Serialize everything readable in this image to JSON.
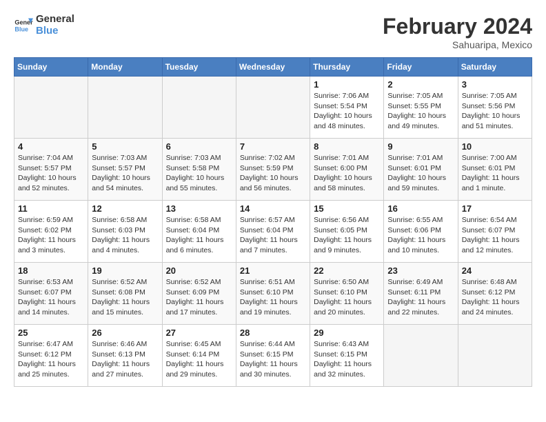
{
  "logo": {
    "line1": "General",
    "line2": "Blue"
  },
  "title": "February 2024",
  "subtitle": "Sahuaripa, Mexico",
  "headers": [
    "Sunday",
    "Monday",
    "Tuesday",
    "Wednesday",
    "Thursday",
    "Friday",
    "Saturday"
  ],
  "weeks": [
    [
      {
        "day": "",
        "info": ""
      },
      {
        "day": "",
        "info": ""
      },
      {
        "day": "",
        "info": ""
      },
      {
        "day": "",
        "info": ""
      },
      {
        "day": "1",
        "info": "Sunrise: 7:06 AM\nSunset: 5:54 PM\nDaylight: 10 hours\nand 48 minutes."
      },
      {
        "day": "2",
        "info": "Sunrise: 7:05 AM\nSunset: 5:55 PM\nDaylight: 10 hours\nand 49 minutes."
      },
      {
        "day": "3",
        "info": "Sunrise: 7:05 AM\nSunset: 5:56 PM\nDaylight: 10 hours\nand 51 minutes."
      }
    ],
    [
      {
        "day": "4",
        "info": "Sunrise: 7:04 AM\nSunset: 5:57 PM\nDaylight: 10 hours\nand 52 minutes."
      },
      {
        "day": "5",
        "info": "Sunrise: 7:03 AM\nSunset: 5:57 PM\nDaylight: 10 hours\nand 54 minutes."
      },
      {
        "day": "6",
        "info": "Sunrise: 7:03 AM\nSunset: 5:58 PM\nDaylight: 10 hours\nand 55 minutes."
      },
      {
        "day": "7",
        "info": "Sunrise: 7:02 AM\nSunset: 5:59 PM\nDaylight: 10 hours\nand 56 minutes."
      },
      {
        "day": "8",
        "info": "Sunrise: 7:01 AM\nSunset: 6:00 PM\nDaylight: 10 hours\nand 58 minutes."
      },
      {
        "day": "9",
        "info": "Sunrise: 7:01 AM\nSunset: 6:01 PM\nDaylight: 10 hours\nand 59 minutes."
      },
      {
        "day": "10",
        "info": "Sunrise: 7:00 AM\nSunset: 6:01 PM\nDaylight: 11 hours\nand 1 minute."
      }
    ],
    [
      {
        "day": "11",
        "info": "Sunrise: 6:59 AM\nSunset: 6:02 PM\nDaylight: 11 hours\nand 3 minutes."
      },
      {
        "day": "12",
        "info": "Sunrise: 6:58 AM\nSunset: 6:03 PM\nDaylight: 11 hours\nand 4 minutes."
      },
      {
        "day": "13",
        "info": "Sunrise: 6:58 AM\nSunset: 6:04 PM\nDaylight: 11 hours\nand 6 minutes."
      },
      {
        "day": "14",
        "info": "Sunrise: 6:57 AM\nSunset: 6:04 PM\nDaylight: 11 hours\nand 7 minutes."
      },
      {
        "day": "15",
        "info": "Sunrise: 6:56 AM\nSunset: 6:05 PM\nDaylight: 11 hours\nand 9 minutes."
      },
      {
        "day": "16",
        "info": "Sunrise: 6:55 AM\nSunset: 6:06 PM\nDaylight: 11 hours\nand 10 minutes."
      },
      {
        "day": "17",
        "info": "Sunrise: 6:54 AM\nSunset: 6:07 PM\nDaylight: 11 hours\nand 12 minutes."
      }
    ],
    [
      {
        "day": "18",
        "info": "Sunrise: 6:53 AM\nSunset: 6:07 PM\nDaylight: 11 hours\nand 14 minutes."
      },
      {
        "day": "19",
        "info": "Sunrise: 6:52 AM\nSunset: 6:08 PM\nDaylight: 11 hours\nand 15 minutes."
      },
      {
        "day": "20",
        "info": "Sunrise: 6:52 AM\nSunset: 6:09 PM\nDaylight: 11 hours\nand 17 minutes."
      },
      {
        "day": "21",
        "info": "Sunrise: 6:51 AM\nSunset: 6:10 PM\nDaylight: 11 hours\nand 19 minutes."
      },
      {
        "day": "22",
        "info": "Sunrise: 6:50 AM\nSunset: 6:10 PM\nDaylight: 11 hours\nand 20 minutes."
      },
      {
        "day": "23",
        "info": "Sunrise: 6:49 AM\nSunset: 6:11 PM\nDaylight: 11 hours\nand 22 minutes."
      },
      {
        "day": "24",
        "info": "Sunrise: 6:48 AM\nSunset: 6:12 PM\nDaylight: 11 hours\nand 24 minutes."
      }
    ],
    [
      {
        "day": "25",
        "info": "Sunrise: 6:47 AM\nSunset: 6:12 PM\nDaylight: 11 hours\nand 25 minutes."
      },
      {
        "day": "26",
        "info": "Sunrise: 6:46 AM\nSunset: 6:13 PM\nDaylight: 11 hours\nand 27 minutes."
      },
      {
        "day": "27",
        "info": "Sunrise: 6:45 AM\nSunset: 6:14 PM\nDaylight: 11 hours\nand 29 minutes."
      },
      {
        "day": "28",
        "info": "Sunrise: 6:44 AM\nSunset: 6:15 PM\nDaylight: 11 hours\nand 30 minutes."
      },
      {
        "day": "29",
        "info": "Sunrise: 6:43 AM\nSunset: 6:15 PM\nDaylight: 11 hours\nand 32 minutes."
      },
      {
        "day": "",
        "info": ""
      },
      {
        "day": "",
        "info": ""
      }
    ]
  ]
}
